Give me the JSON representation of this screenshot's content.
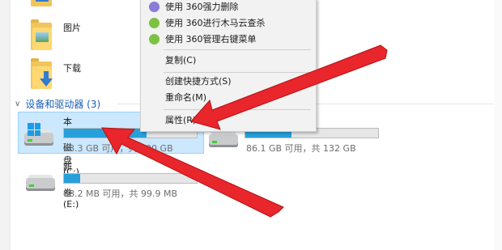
{
  "folders": [
    {
      "label": "图片",
      "badge_color": "#4a90c8"
    },
    {
      "label": "下载",
      "badge_color": "#2f7cd0"
    }
  ],
  "section": {
    "chevron": "chevron-down-icon",
    "title": "设备和驱动器 (3)"
  },
  "drives": [
    {
      "name": "本地磁盘 (C:)",
      "info": "38.3 GB 可用，共 100 GB",
      "used_fraction": 0.62
    },
    {
      "name": "",
      "info": "86.1 GB 可用，共 132 GB",
      "used_fraction": 0.35
    },
    {
      "name": "新加卷 (E:)",
      "info": "88.2 MB 可用，共 99.9 MB",
      "used_fraction": 0.12
    }
  ],
  "context_menu": {
    "items": [
      {
        "label": "使用 360强力删除",
        "icon": "360-delete-icon",
        "icon_color": "#8b7ad8"
      },
      {
        "label": "使用 360进行木马云查杀",
        "icon": "360-trojan-scan-icon",
        "icon_color": "#7cc242"
      },
      {
        "label": "使用 360管理右键菜单",
        "icon": "360-menu-manager-icon",
        "icon_color": "#7cc242"
      },
      {
        "label": "复制(C)"
      },
      {
        "label": "创建快捷方式(S)"
      },
      {
        "label": "重命名(M)"
      },
      {
        "label": "属性(R)"
      }
    ]
  },
  "colors": {
    "accent": "#26a0da",
    "arrow": "#e8262b",
    "selection": "#cce8ff"
  }
}
